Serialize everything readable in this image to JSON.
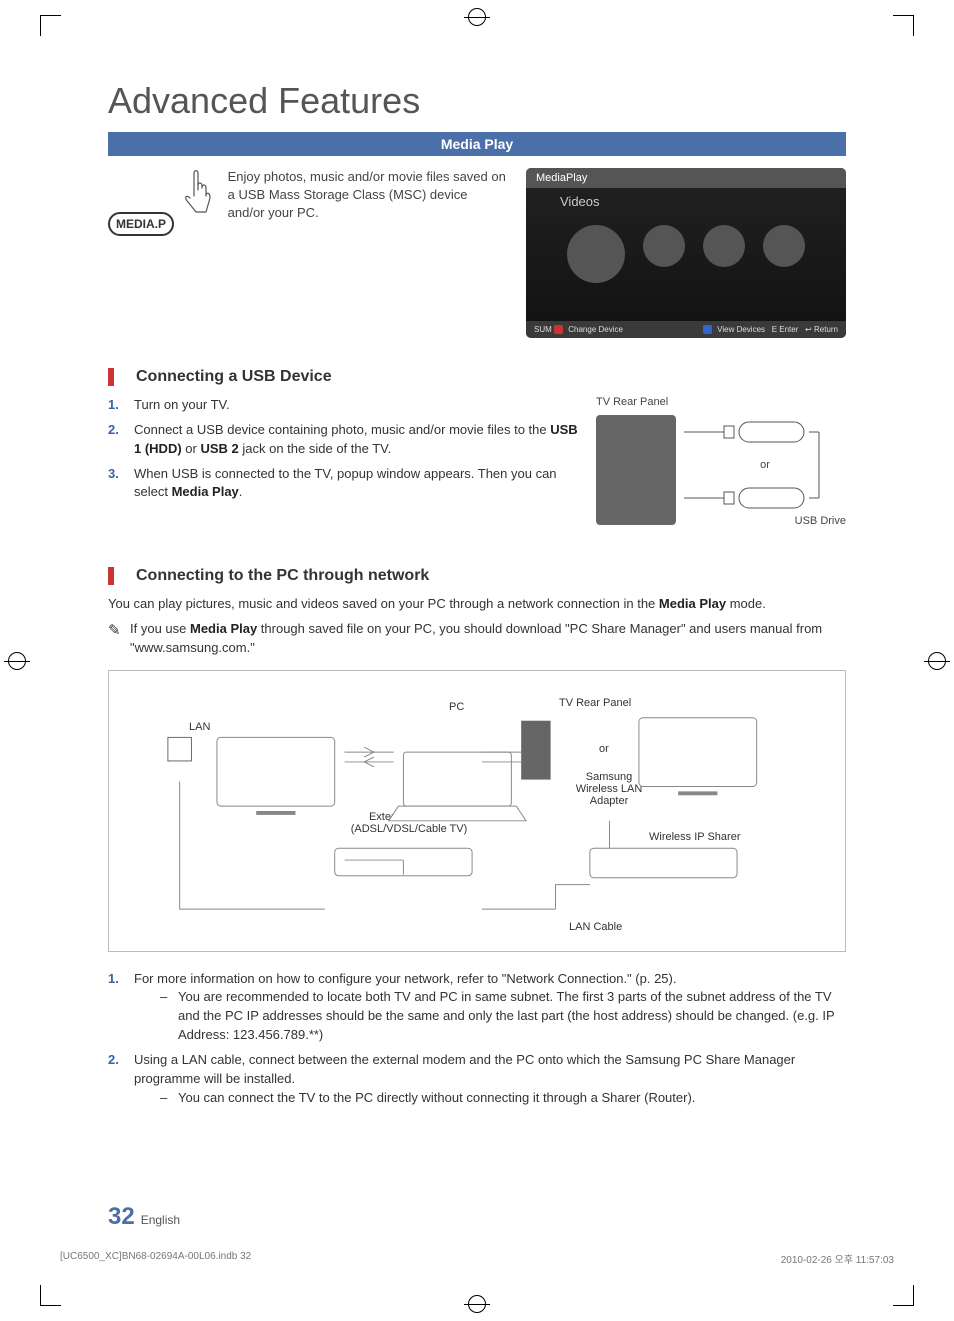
{
  "page": {
    "title": "Advanced Features",
    "bar": "Media Play",
    "remote_button": "MEDIA.P",
    "intro": "Enjoy photos, music and/or movie files saved on a USB Mass Storage Class (MSC) device and/or your PC.",
    "page_number": "32",
    "page_lang": "English"
  },
  "screenshot": {
    "title": "MediaPlay",
    "subtitle": "Videos",
    "foot_left_prefix": "SUM",
    "foot_left_action": "Change Device",
    "foot_right_view": "View Devices",
    "foot_right_enter": "Enter",
    "foot_right_return": "Return"
  },
  "section1": {
    "title": "Connecting a USB Device",
    "steps": [
      "Turn on your TV.",
      "Connect a USB device containing photo, music and/or movie files to the USB 1 (HDD) or USB 2 jack on the side of the TV.",
      "When USB is connected to the TV, popup window appears. Then you can select Media Play."
    ],
    "fig_caption": "TV Rear Panel",
    "fig_or": "or",
    "fig_usb": "USB Drive"
  },
  "section2": {
    "title": "Connecting to the PC through network",
    "lead": "You can play pictures, music and videos saved on your PC through a network connection in the Media Play mode.",
    "note": "If you use Media Play through saved file on your PC, you should download \"PC Share Manager\" and users manual from \"www.samsung.com.\"",
    "diagram": {
      "lan": "LAN",
      "pc": "PC",
      "tv": "TV Rear Panel",
      "or": "or",
      "adapter": "Samsung Wireless LAN Adapter",
      "modem": "External Modem (ADSL/VDSL/Cable TV)",
      "sharer": "Wireless IP Sharer",
      "cable": "LAN Cable"
    },
    "steps": [
      {
        "text": "For more information on how to configure your network, refer to \"Network Connection.\" (p. 25).",
        "sub": "You are recommended to locate both TV and PC in same subnet. The first 3 parts of the subnet address of the TV and the PC IP addresses should be the same and only the last part (the host address) should be changed. (e.g. IP Address: 123.456.789.**)"
      },
      {
        "text": "Using a LAN cable, connect between the external modem and the PC onto which the Samsung PC Share Manager programme will be installed.",
        "sub": "You can connect the TV to the PC directly without connecting it through a Sharer (Router)."
      }
    ]
  },
  "footer": {
    "left": "[UC6500_XC]BN68-02694A-00L06.indb   32",
    "right": "2010-02-26   오후 11:57:03"
  }
}
